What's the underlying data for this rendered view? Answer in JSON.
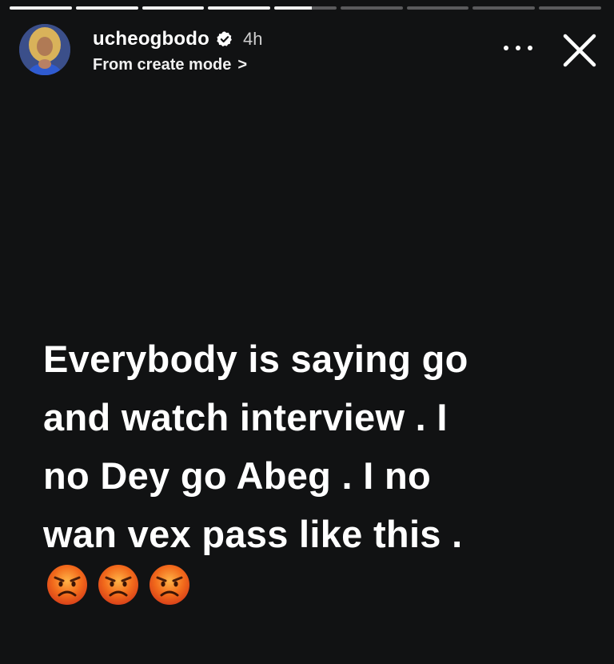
{
  "story": {
    "segments": [
      {
        "progress": 1
      },
      {
        "progress": 1
      },
      {
        "progress": 1
      },
      {
        "progress": 1
      },
      {
        "progress": 0.6
      },
      {
        "progress": 0
      },
      {
        "progress": 0
      },
      {
        "progress": 0
      },
      {
        "progress": 0
      }
    ],
    "username": "ucheogbodo",
    "verified": true,
    "time_ago": "4h",
    "source_label": "From create mode",
    "source_chevron": ">",
    "text_lines": [
      "Everybody is saying go",
      "and watch interview . I",
      "no Dey go Abeg . I no",
      "wan vex pass like this ."
    ],
    "emojis": [
      "angry-face",
      "angry-face",
      "angry-face"
    ]
  },
  "colors": {
    "background": "#111213",
    "text": "#ffffff",
    "progress_track": "#5a5a5c",
    "progress_fill": "#f2f2f2",
    "verified_badge": "#ffffff"
  },
  "icons": {
    "more": "more-options-icon",
    "close": "close-icon",
    "verified": "verified-badge-icon"
  }
}
